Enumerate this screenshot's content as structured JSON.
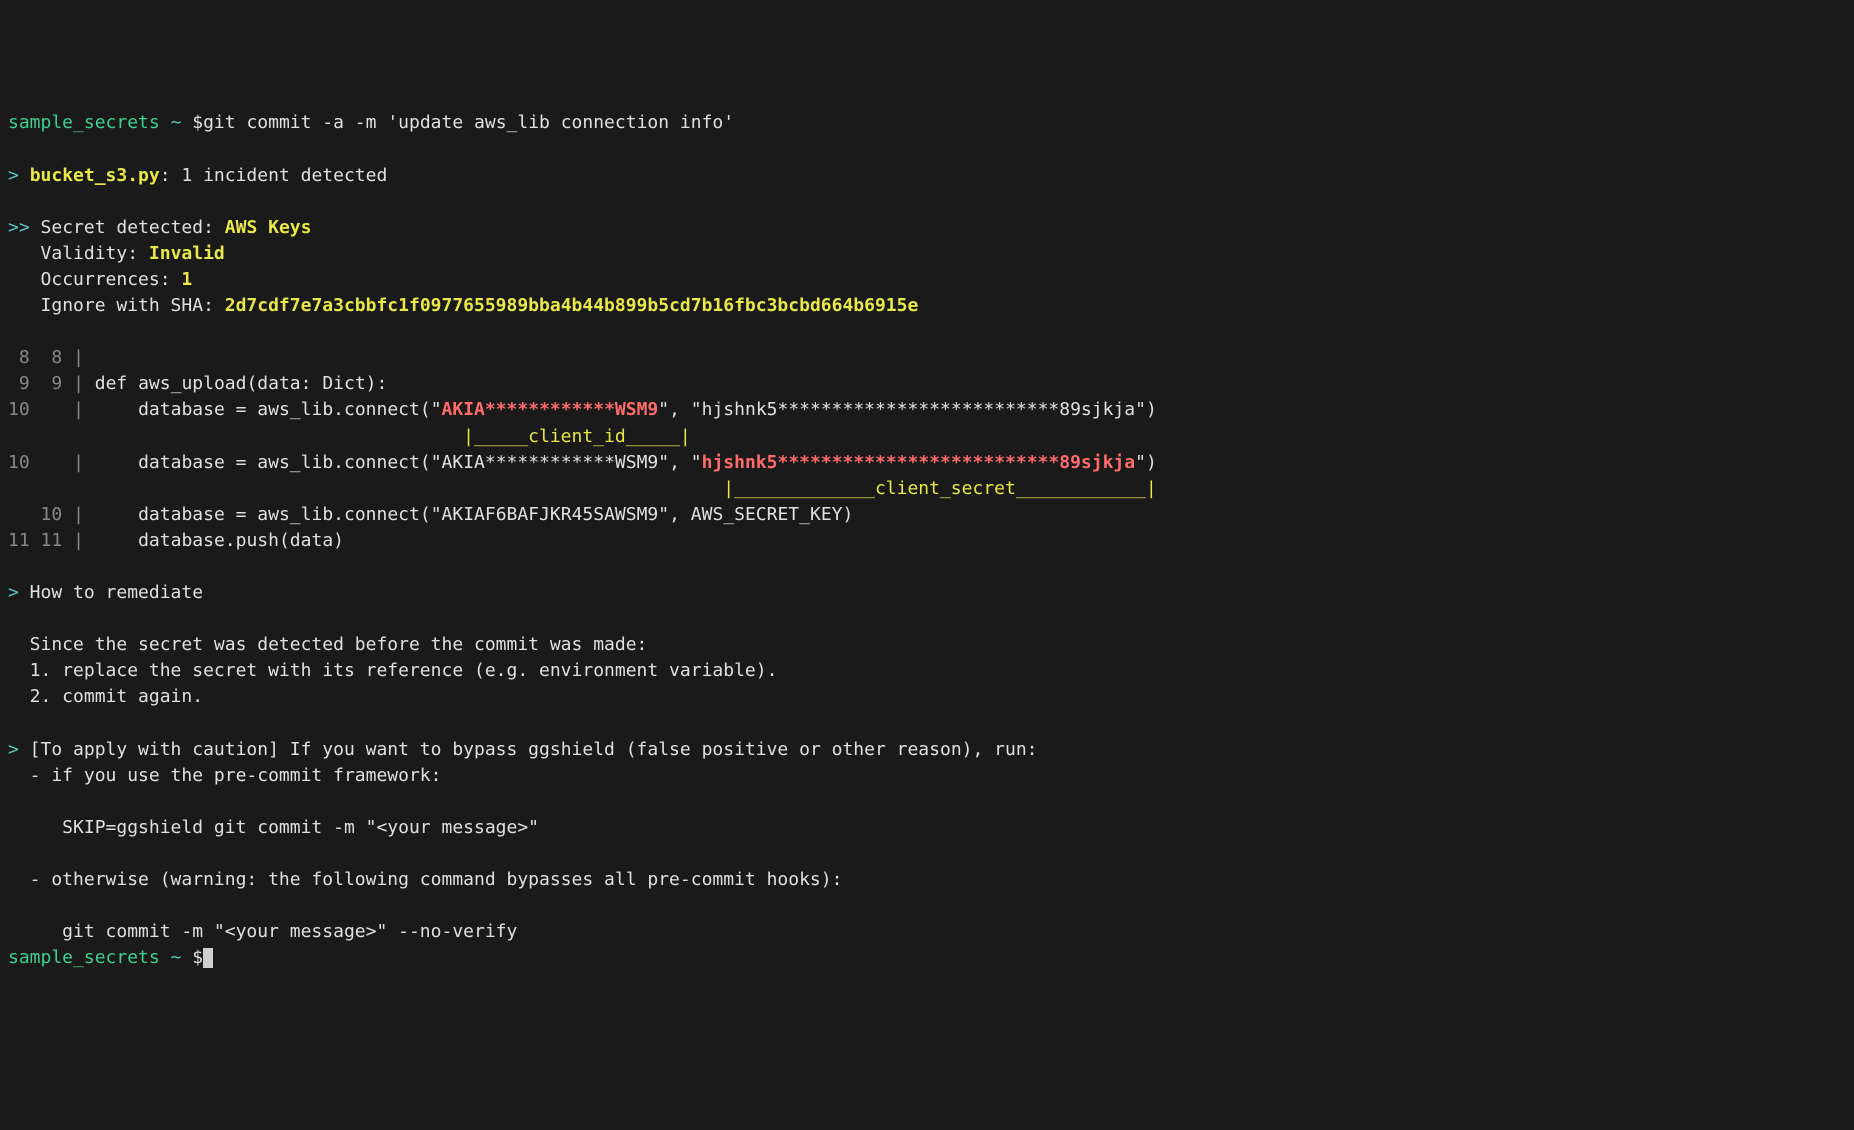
{
  "prompt1": {
    "cwd": "sample_secrets",
    "sep": "~",
    "dollar": "$",
    "cmd": "git commit -a -m 'update aws_lib connection info'"
  },
  "incident": {
    "marker": ">",
    "filename": "bucket_s3.py",
    "suffix": ": 1 incident detected"
  },
  "detect": {
    "marker": ">>",
    "label": "Secret detected: ",
    "type": "AWS Keys",
    "validity_label": "Validity: ",
    "validity_value": "Invalid",
    "occurrences_label": "Occurrences: ",
    "occurrences_value": "1",
    "ignore_label": "Ignore with SHA: ",
    "ignore_sha": "2d7cdf7e7a3cbbfc1f0977655989bba4b44b899b5cd7b16fbc3bcbd664b6915e"
  },
  "diff": {
    "r1": {
      "a": " 8",
      "b": " 8",
      "pipe": "|",
      "code": ""
    },
    "r2": {
      "a": " 9",
      "b": " 9",
      "pipe": "|",
      "code": " def aws_upload(data: Dict):"
    },
    "r3": {
      "a": "10",
      "b": "  ",
      "pipe": "|",
      "pre": "     database = aws_lib.connect(\"",
      "key1": "AKIA************WSM9",
      "mid": "\", \"hjshnk5**************************89sjkja\")"
    },
    "r3u": {
      "underline": "                                          |_____client_id_____|"
    },
    "r4": {
      "a": "10",
      "b": "  ",
      "pipe": "|",
      "pre": "     database = aws_lib.connect(\"AKIA************WSM9\", \"",
      "key2": "hjshnk5**************************89sjkja",
      "post": "\")"
    },
    "r4u": {
      "underline": "                                                                  |_____________client_secret____________|"
    },
    "r5": {
      "a": "  ",
      "b": "10",
      "pipe": "|",
      "code": "     database = aws_lib.connect(\"AKIAF6BAFJKR45SAWSM9\", AWS_SECRET_KEY)"
    },
    "r6": {
      "a": "11",
      "b": "11",
      "pipe": "|",
      "code": "     database.push(data)"
    }
  },
  "remediate": {
    "marker": ">",
    "title": " How to remediate",
    "line1": "  Since the secret was detected before the commit was made:",
    "line2": "  1. replace the secret with its reference (e.g. environment variable).",
    "line3": "  2. commit again."
  },
  "bypass": {
    "marker": ">",
    "title": " [To apply with caution] If you want to bypass ggshield (false positive or other reason), run:",
    "line1": "  - if you use the pre-commit framework:",
    "cmd1": "     SKIP=ggshield git commit -m \"<your message>\"",
    "line2": "  - otherwise (warning: the following command bypasses all pre-commit hooks):",
    "cmd2": "     git commit -m \"<your message>\" --no-verify"
  },
  "prompt2": {
    "cwd": "sample_secrets",
    "sep": "~",
    "dollar": "$"
  }
}
